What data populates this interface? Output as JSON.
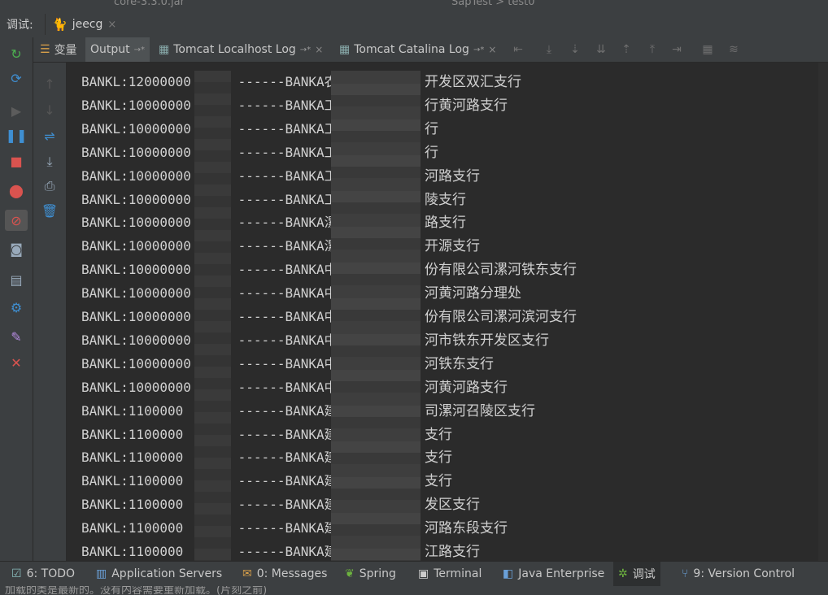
{
  "top": {
    "crumb_left": "core-3.3.0.jar",
    "crumb_right": "SapTest  >  test0"
  },
  "debug_panel": {
    "label": "调试:",
    "session_tab": "jeecg",
    "session_close": "×"
  },
  "subtabs": [
    {
      "label": "变量",
      "active": false
    },
    {
      "label": "Output",
      "active": true,
      "pin": "→*"
    },
    {
      "label": "Tomcat Localhost Log",
      "pin": "→*",
      "close": "×"
    },
    {
      "label": "Tomcat Catalina Log",
      "pin": "→*",
      "close": "×"
    }
  ],
  "console": {
    "lines": [
      {
        "text": "BANKL:12000000      ------BANKA农",
        "suffix": "开发区双汇支行"
      },
      {
        "text": "BANKL:10000000      ------BANKA工",
        "suffix": "行黄河路支行"
      },
      {
        "text": "BANKL:10000000      ------BANKA工",
        "suffix": "行"
      },
      {
        "text": "BANKL:10000000      ------BANKA工",
        "suffix": "行"
      },
      {
        "text": "BANKL:10000000      ------BANKA工",
        "suffix": "河路支行"
      },
      {
        "text": "BANKL:10000000      ------BANKA工",
        "suffix": "陵支行"
      },
      {
        "text": "BANKL:10000000      ------BANKA漯",
        "suffix": "路支行"
      },
      {
        "text": "BANKL:10000000      ------BANKA漯",
        "suffix": "开源支行"
      },
      {
        "text": "BANKL:10000000      ------BANKA中",
        "suffix": "份有限公司漯河铁东支行"
      },
      {
        "text": "BANKL:10000000      ------BANKA中",
        "suffix": "河黄河路分理处"
      },
      {
        "text": "BANKL:10000000      ------BANKA中",
        "suffix": "份有限公司漯河滨河支行"
      },
      {
        "text": "BANKL:10000000      ------BANKA中",
        "suffix": "河市铁东开发区支行"
      },
      {
        "text": "BANKL:10000000      ------BANKA中",
        "suffix": "河铁东支行"
      },
      {
        "text": "BANKL:10000000      ------BANKA中",
        "suffix": "河黄河路支行"
      },
      {
        "text": "BANKL:1100000       ------BANKA建",
        "suffix": "司漯河召陵区支行"
      },
      {
        "text": "BANKL:1100000       ------BANKA建",
        "suffix": "支行"
      },
      {
        "text": "BANKL:1100000       ------BANKA建",
        "suffix": "支行"
      },
      {
        "text": "BANKL:1100000       ------BANKA建",
        "suffix": "支行"
      },
      {
        "text": "BANKL:1100000       ------BANKA建",
        "suffix": "发区支行"
      },
      {
        "text": "BANKL:1100000       ------BANKA建",
        "suffix": "河路东段支行"
      },
      {
        "text": "BANKL:1100000       ------BANKA建",
        "suffix": "江路支行"
      }
    ]
  },
  "bottom_tabs": [
    {
      "label": "6: TODO",
      "icon": "todo-icon"
    },
    {
      "label": "Application Servers",
      "icon": "server-icon"
    },
    {
      "label": "0: Messages",
      "icon": "messages-icon"
    },
    {
      "label": "Spring",
      "icon": "spring-icon"
    },
    {
      "label": "Terminal",
      "icon": "terminal-icon"
    },
    {
      "label": "Java Enterprise",
      "icon": "java-enterprise-icon"
    },
    {
      "label": "调试",
      "icon": "debug-icon",
      "active": true
    },
    {
      "label": "9: Version Control",
      "icon": "version-control-icon"
    }
  ],
  "status_text": "加载的类是最新的。没有内容需要重新加载。(片刻之前)",
  "colors": {
    "bg": "#2b2b2b",
    "panel": "#3c3f41",
    "text": "#d0d0d0",
    "resume_green": "#4caf50",
    "stop_red": "#d9534f",
    "pause_blue": "#3f8fd2"
  }
}
